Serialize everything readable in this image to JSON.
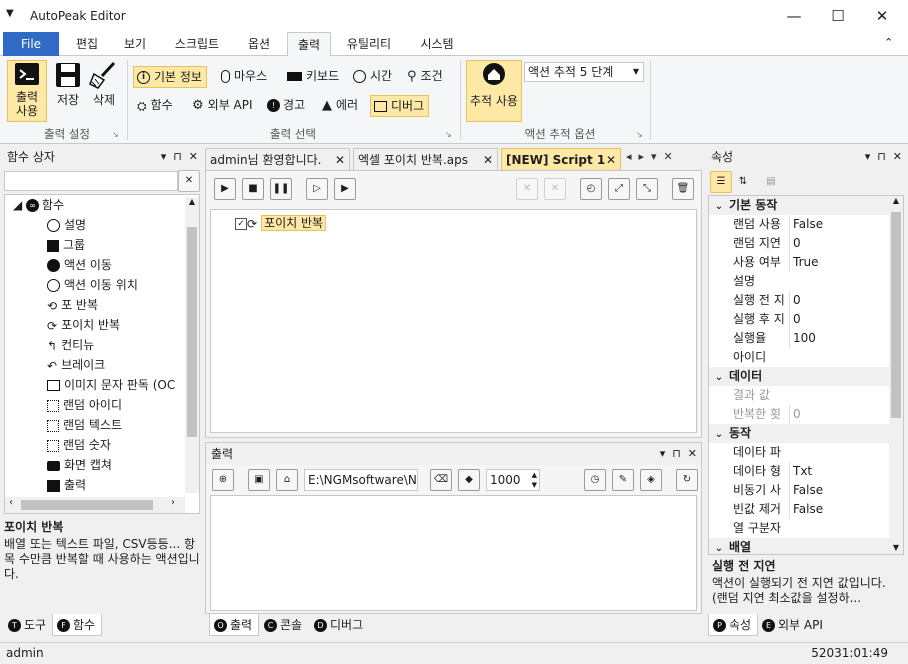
{
  "app": {
    "title": "AutoPeak Editor"
  },
  "ribbon_tabs": [
    "File",
    "편집",
    "보기",
    "스크립트",
    "옵션",
    "출력",
    "유틸리티",
    "시스템"
  ],
  "ribbon": {
    "output_settings": {
      "print_use": "출력\n사용",
      "save": "저장",
      "delete": "삭제",
      "label": "출력 설정"
    },
    "output_select": {
      "basic_info": "기본 정보",
      "mouse": "마우스",
      "keyboard": "키보드",
      "time": "시간",
      "condition": "조건",
      "function": "함수",
      "external_api": "외부 API",
      "warning": "경고",
      "error": "에러",
      "debug": "디버그",
      "label": "출력 선택"
    },
    "action_trace": {
      "trace_use": "추적 사용",
      "level": "액션 추적 5 단계",
      "label": "액션 추적 옵션"
    }
  },
  "left_panel": {
    "title": "함수 상자",
    "root": "함수",
    "items": [
      "설명",
      "그룹",
      "액션 이동",
      "액션 이동 위치",
      "포 반복",
      "포이치 반복",
      "컨티뉴",
      "브레이크",
      "이미지 문자 판독 (OC",
      "랜덤 아이디",
      "랜덤 텍스트",
      "랜덤 숫자",
      "화면 캡쳐",
      "출력"
    ],
    "desc_title": "포이치 반복",
    "desc_text": "배열 또는 텍스트 파일, CSV등등... 항목 수만큼 반복할 때 사용하는 액션입니다.",
    "tabs": [
      "도구",
      "함수"
    ]
  },
  "doc_tabs": [
    "admin님 환영합니다.",
    "엑셀 포이치 반복.aps",
    "[NEW] Script 1"
  ],
  "script": {
    "node_label": "포이치 반복"
  },
  "output_panel": {
    "title": "출력",
    "path": "E:\\NGMsoftware\\NG",
    "count": "1000",
    "tabs": [
      "출력",
      "콘솔",
      "디버그"
    ]
  },
  "props": {
    "title": "속성",
    "sections": [
      {
        "name": "기본 동작",
        "rows": [
          [
            "랜덤 사용",
            "False"
          ],
          [
            "랜덤 지연",
            "0"
          ],
          [
            "사용 여부",
            "True"
          ],
          [
            "설명",
            ""
          ],
          [
            "실행 전 지",
            "0"
          ],
          [
            "실행 후 지",
            "0"
          ],
          [
            "실행율",
            "100"
          ],
          [
            "아이디",
            ""
          ]
        ]
      },
      {
        "name": "데이터",
        "rows": [
          [
            "결과 값",
            ""
          ],
          [
            "반복한 횟",
            "0"
          ]
        ]
      },
      {
        "name": "동작",
        "rows": [
          [
            "데이타 파",
            ""
          ],
          [
            "데이타 형",
            "Txt"
          ],
          [
            "비동기 사",
            "False"
          ],
          [
            "빈값 제거",
            "False"
          ],
          [
            "열 구분자",
            ""
          ]
        ]
      },
      {
        "name": "배열",
        "rows": []
      }
    ],
    "desc_title": "실행 전 지연",
    "desc_text": "액션이 실행되기 전 지연 값입니다. (랜덤 지연 최소값을 설정하...",
    "tabs": [
      "속성",
      "외부 API"
    ]
  },
  "status": {
    "user": "admin",
    "time": "52031:01:49"
  }
}
